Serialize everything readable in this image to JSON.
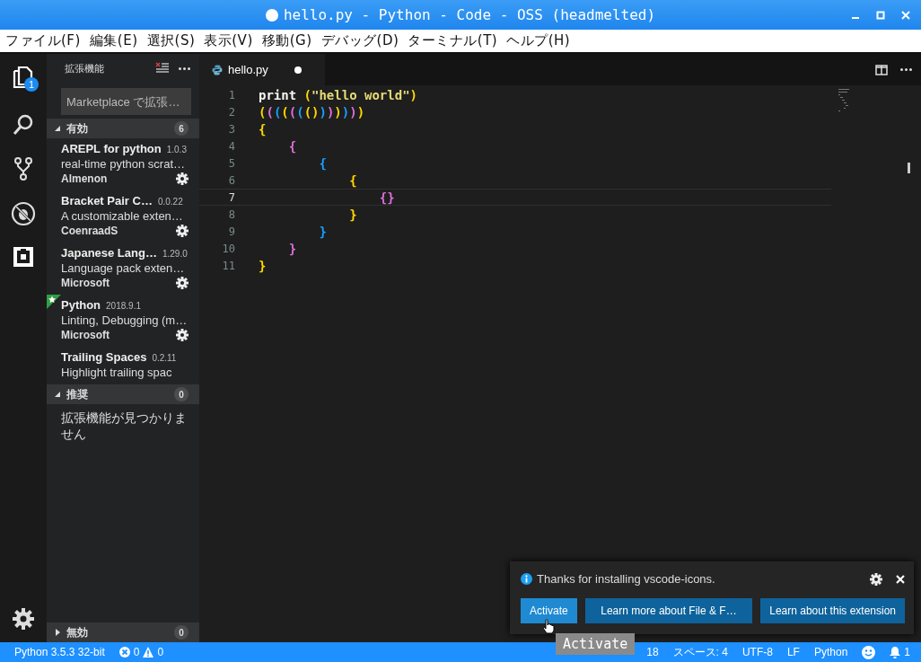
{
  "window": {
    "title": "hello.py - Python - Code - OSS (headmelted)",
    "dirty": true
  },
  "menu": [
    "ファイル(F)",
    "編集(E)",
    "選択(S)",
    "表示(V)",
    "移動(G)",
    "デバッグ(D)",
    "ターミナル(T)",
    "ヘルプ(H)"
  ],
  "activity_bar": {
    "badge": "1"
  },
  "sidebar": {
    "title": "拡張機能",
    "search": {
      "placeholder": "Marketplace で拡張…"
    },
    "sections": [
      {
        "title": "有効",
        "count": "6",
        "expanded": true,
        "extensions": [
          {
            "name": "AREPL for python",
            "version": "1.0.3",
            "description": "real-time python scrat…",
            "publisher": "Almenon",
            "starred": false
          },
          {
            "name": "Bracket Pair C…",
            "version": "0.0.22",
            "description": "A customizable exten…",
            "publisher": "CoenraadS",
            "starred": false
          },
          {
            "name": "Japanese Lang…",
            "version": "1.29.0",
            "description": "Language pack exten…",
            "publisher": "Microsoft",
            "starred": false
          },
          {
            "name": "Python",
            "version": "2018.9.1",
            "description": "Linting, Debugging (m…",
            "publisher": "Microsoft",
            "starred": true
          },
          {
            "name": "Trailing Spaces",
            "version": "0.2.11",
            "description": "Highlight trailing spac",
            "starred": false
          }
        ]
      },
      {
        "title": "推奨",
        "count": "0",
        "expanded": true,
        "message": "拡張機能が見つかりません"
      },
      {
        "title": "無効",
        "count": "0",
        "expanded": false
      }
    ]
  },
  "editor": {
    "tab": {
      "label": "hello.py",
      "dirty": true
    },
    "lines": [
      {
        "number": "1",
        "current": false,
        "tokens": [
          {
            "text": "print ",
            "color": "#f8f8f2"
          },
          {
            "text": "(",
            "color": "#ffd700"
          },
          {
            "text": "\"hello world\"",
            "color": "#e6db74"
          },
          {
            "text": ")",
            "color": "#ffd700"
          }
        ]
      },
      {
        "number": "2",
        "current": false,
        "tokens": [
          {
            "text": "(",
            "color": "#ffd700"
          },
          {
            "text": "(",
            "color": "#da70d6"
          },
          {
            "text": "(",
            "color": "#179fff"
          },
          {
            "text": "(",
            "color": "#ffd700"
          },
          {
            "text": "(",
            "color": "#da70d6"
          },
          {
            "text": "(",
            "color": "#179fff"
          },
          {
            "text": "()",
            "color": "#ffd700"
          },
          {
            "text": ")",
            "color": "#179fff"
          },
          {
            "text": ")",
            "color": "#da70d6"
          },
          {
            "text": ")",
            "color": "#ffd700"
          },
          {
            "text": ")",
            "color": "#179fff"
          },
          {
            "text": ")",
            "color": "#da70d6"
          },
          {
            "text": ")",
            "color": "#ffd700"
          }
        ]
      },
      {
        "number": "3",
        "current": false,
        "tokens": [
          {
            "text": "{",
            "color": "#ffd700"
          }
        ]
      },
      {
        "number": "4",
        "current": false,
        "tokens": [
          {
            "text": "    {",
            "color": "#da70d6"
          }
        ]
      },
      {
        "number": "5",
        "current": false,
        "tokens": [
          {
            "text": "        {",
            "color": "#179fff"
          }
        ]
      },
      {
        "number": "6",
        "current": false,
        "tokens": [
          {
            "text": "            {",
            "color": "#ffd700"
          }
        ]
      },
      {
        "number": "7",
        "current": true,
        "tokens": [
          {
            "text": "                {}",
            "color": "#da70d6"
          }
        ]
      },
      {
        "number": "8",
        "current": false,
        "tokens": [
          {
            "text": "            }",
            "color": "#ffd700"
          }
        ]
      },
      {
        "number": "9",
        "current": false,
        "tokens": [
          {
            "text": "        }",
            "color": "#179fff"
          }
        ]
      },
      {
        "number": "10",
        "current": false,
        "tokens": [
          {
            "text": "    }",
            "color": "#da70d6"
          }
        ]
      },
      {
        "number": "11",
        "current": false,
        "tokens": [
          {
            "text": "}",
            "color": "#ffd700"
          }
        ]
      }
    ]
  },
  "notification": {
    "message": "Thanks for installing vscode-icons.",
    "buttons": [
      {
        "label": "Activate",
        "selected": true
      },
      {
        "label": "Learn more about File & F…",
        "selected": false
      },
      {
        "label": "Learn about this extension",
        "selected": false
      }
    ]
  },
  "tooltip": "Activate",
  "status_bar": {
    "interpreter": "Python 3.5.3 32-bit",
    "errors": "0",
    "warnings": "0",
    "column": "18",
    "indent": "スペース: 4",
    "encoding": "UTF-8",
    "eol": "LF",
    "language": "Python",
    "notifications": "1"
  }
}
